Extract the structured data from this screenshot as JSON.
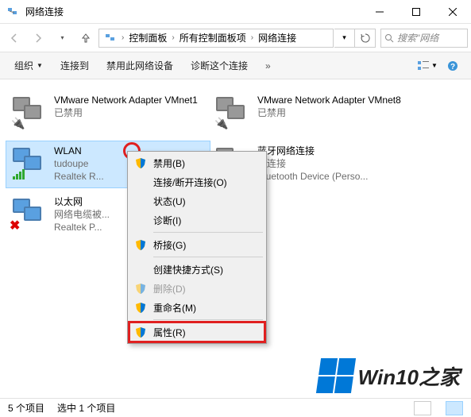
{
  "window": {
    "title": "网络连接"
  },
  "nav": {
    "breadcrumb": [
      "控制面板",
      "所有控制面板项",
      "网络连接"
    ],
    "search_placeholder": "搜索\"网络"
  },
  "toolbar": {
    "organize": "组织",
    "connect": "连接到",
    "disable_device": "禁用此网络设备",
    "diagnose": "诊断这个连接"
  },
  "adapters": [
    {
      "name": "VMware Network Adapter VMnet1",
      "status": "已禁用",
      "driver": ""
    },
    {
      "name": "VMware Network Adapter VMnet8",
      "status": "已禁用",
      "driver": ""
    },
    {
      "name": "WLAN",
      "status": "tudoupe",
      "driver": "Realtek R..."
    },
    {
      "name": "蓝牙网络连接",
      "status": "未连接",
      "driver": "Bluetooth Device (Perso..."
    },
    {
      "name": "以太网",
      "status": "网络电缆被...",
      "driver": "Realtek P..."
    }
  ],
  "context_menu": {
    "disable": "禁用(B)",
    "connect_disconnect": "连接/断开连接(O)",
    "status": "状态(U)",
    "diagnose": "诊断(I)",
    "bridge": "桥接(G)",
    "shortcut": "创建快捷方式(S)",
    "delete": "删除(D)",
    "rename": "重命名(M)",
    "properties": "属性(R)"
  },
  "statusbar": {
    "count": "5 个项目",
    "selected": "选中 1 个项目"
  },
  "watermark": {
    "text": "Win10之家"
  }
}
